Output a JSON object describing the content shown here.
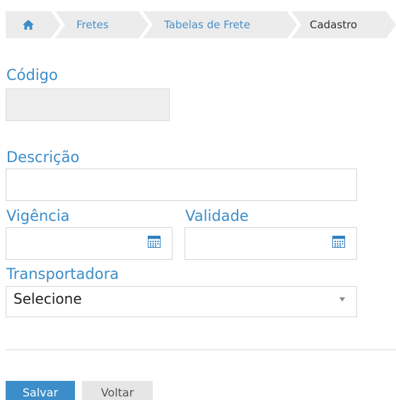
{
  "breadcrumb": {
    "home_icon": "home-icon",
    "items": [
      {
        "label": "Fretes"
      },
      {
        "label": "Tabelas de Frete"
      },
      {
        "label": "Cadastro"
      }
    ]
  },
  "form": {
    "codigo": {
      "label": "Código",
      "value": ""
    },
    "descricao": {
      "label": "Descrição",
      "value": ""
    },
    "vigencia": {
      "label": "Vigência",
      "value": "",
      "icon": "calendar-icon"
    },
    "validade": {
      "label": "Validade",
      "value": "",
      "icon": "calendar-icon"
    },
    "transportadora": {
      "label": "Transportadora",
      "selected": "Selecione"
    }
  },
  "actions": {
    "save_label": "Salvar",
    "back_label": "Voltar"
  },
  "colors": {
    "accent": "#3c8dc9",
    "breadcrumb_bg": "#ececec"
  }
}
